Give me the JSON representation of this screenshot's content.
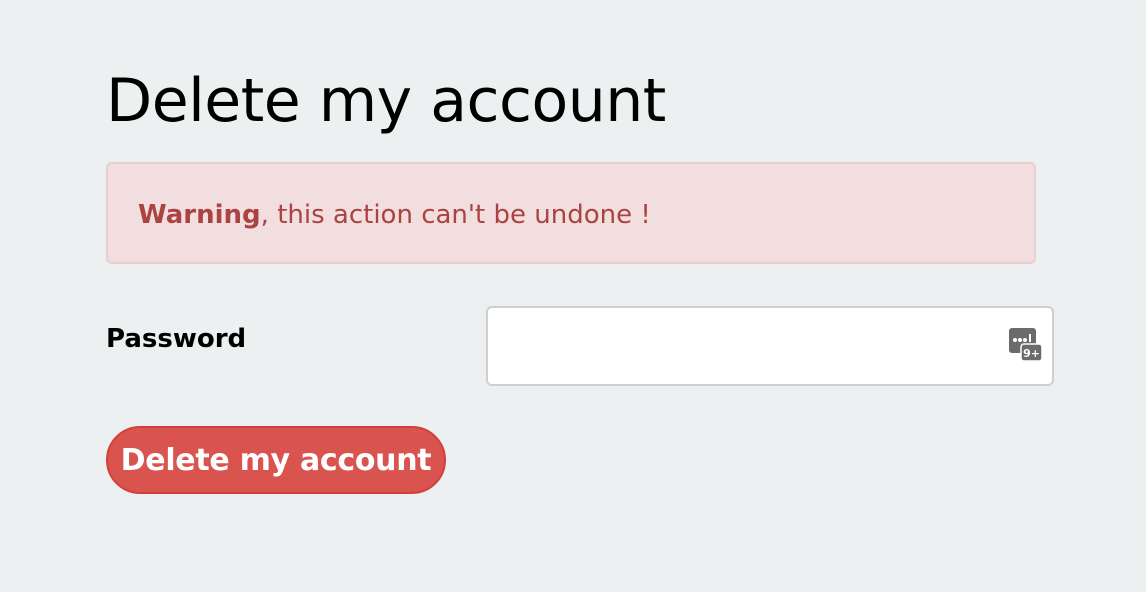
{
  "page": {
    "title": "Delete my account"
  },
  "alert": {
    "strong_text": "Warning",
    "message": ", this action can't be undone !",
    "background_color": "#f2dede",
    "text_color": "#a94442"
  },
  "form": {
    "password_label": "Password",
    "password_value": "",
    "password_manager_icon": "password-manager-icon",
    "password_manager_badge": "9+",
    "submit_label": "Delete my account",
    "submit_color": "#d9534f"
  }
}
